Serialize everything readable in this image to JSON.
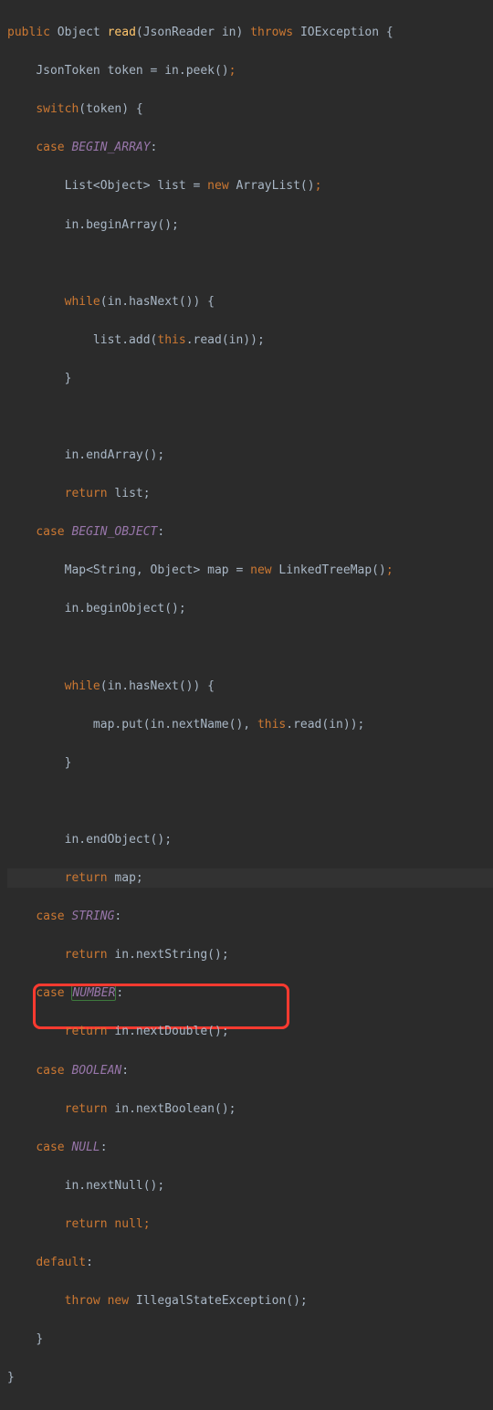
{
  "code": {
    "declaration": {
      "access": "public",
      "return_type": "Object",
      "method_name": "read",
      "param_type": "JsonReader",
      "param_name": "in",
      "throws_kw": "throws",
      "throws_type": "IOException",
      "open_brace": "{"
    },
    "body": {
      "token_decl": {
        "type": "JsonToken",
        "name": "token",
        "eq": " = ",
        "expr": "in.peek()",
        "semi": ";"
      },
      "switch_kw": "switch",
      "switch_expr": "(token)",
      "case_kw": "case",
      "cases": {
        "begin_array": {
          "label": "BEGIN_ARRAY",
          "list_decl": "List<Object> list = ",
          "new_kw": "new",
          "list_ctor": " ArrayList()",
          "begin_call": "in.beginArray();",
          "while_kw": "while",
          "while_cond": "(in.hasNext()) {",
          "while_body": "list.add(",
          "this_kw": "this",
          "while_body_tail": ".read(in));",
          "end_call": "in.endArray();",
          "return_kw": "return",
          "return_val": " list;"
        },
        "begin_object": {
          "label": "BEGIN_OBJECT",
          "map_decl": "Map<String, Object> map = ",
          "new_kw": "new",
          "map_ctor": " LinkedTreeMap()",
          "begin_call": "in.beginObject();",
          "while_kw": "while",
          "while_cond": "(in.hasNext()) {",
          "while_body_head": "map.put(in.nextName(), ",
          "this_kw": "this",
          "while_body_tail": ".read(in));",
          "end_call": "in.endObject();",
          "return_kw": "return",
          "return_val": " map;"
        },
        "string": {
          "label": "STRING",
          "return_kw": "return",
          "return_expr": " in.nextString();"
        },
        "number": {
          "label": "NUMBER",
          "return_kw": "return",
          "return_expr": " in.nextDouble();"
        },
        "boolean": {
          "label": "BOOLEAN",
          "return_kw": "return",
          "return_expr": " in.nextBoolean();"
        },
        "null_case": {
          "label": "NULL",
          "stmt": "in.nextNull();",
          "return_kw": "return",
          "null_kw": "null"
        },
        "default": {
          "label": "default",
          "throw_kw": "throw",
          "new_kw": "new",
          "exc": " IllegalStateException();"
        }
      }
    },
    "brace_close": "}"
  },
  "annotation": {
    "highlighted_case": "NUMBER",
    "redbox_target_lines": [
      "case NUMBER:",
      "return in.nextDouble();"
    ],
    "caret_line_text": "return map;"
  }
}
